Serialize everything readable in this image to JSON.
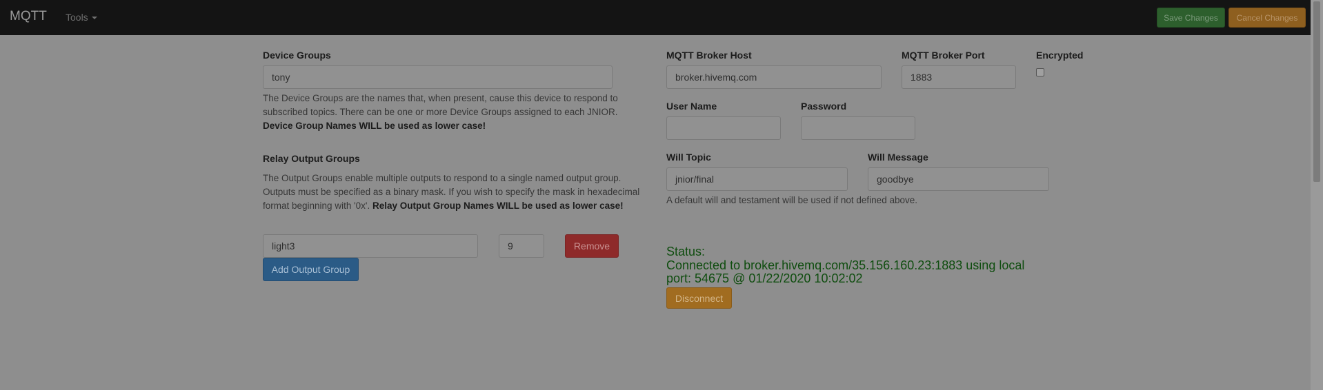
{
  "navbar": {
    "brand": "MQTT",
    "tools_label": "Tools",
    "save_label": "Save Changes",
    "cancel_label": "Cancel Changes"
  },
  "device_groups": {
    "label": "Device Groups",
    "value": "tony",
    "help_text": "The Device Groups are the names that, when present, cause this device to respond to subscribed topics. There can be one or more Device Groups assigned to each JNIOR. ",
    "help_bold": "Device Group Names WILL be used as lower case!"
  },
  "relay_output_groups": {
    "label": "Relay Output Groups",
    "help_text": "The Output Groups enable multiple outputs to respond to a single named output group. Outputs must be specified as a binary mask. If you wish to specify the mask in hexadecimal format beginning with '0x'. ",
    "help_bold": "Relay Output Group Names WILL be used as lower case!",
    "group_name": "light3",
    "group_mask": "9",
    "remove_label": "Remove",
    "add_label": "Add Output Group"
  },
  "broker": {
    "host_label": "MQTT Broker Host",
    "host_value": "broker.hivemq.com",
    "port_label": "MQTT Broker Port",
    "port_value": "1883",
    "encrypted_label": "Encrypted",
    "encrypted_checked": false,
    "username_label": "User Name",
    "username_value": "",
    "password_label": "Password",
    "password_value": "",
    "will_topic_label": "Will Topic",
    "will_topic_value": "jnior/final",
    "will_message_label": "Will Message",
    "will_message_value": "goodbye",
    "will_help": "A default will and testament will be used if not defined above."
  },
  "status": {
    "heading": "Status:",
    "message": "Connected to broker.hivemq.com/35.156.160.23:1883 using local port: 54675 @ 01/22/2020 10:02:02",
    "disconnect_label": "Disconnect"
  }
}
